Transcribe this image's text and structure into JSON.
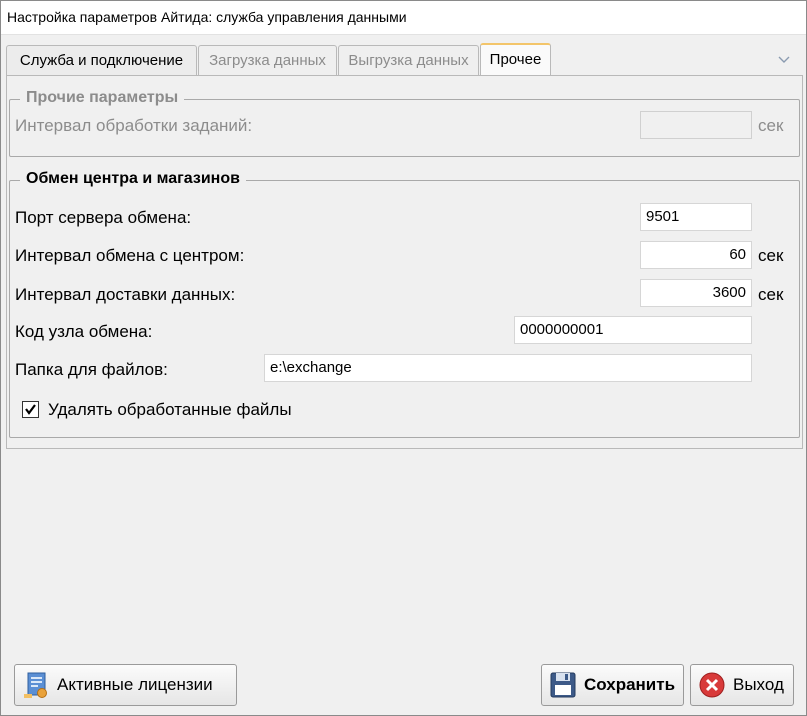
{
  "window": {
    "title": "Настройка параметров Айтида: служба управления данными"
  },
  "tabs": [
    {
      "label": "Служба и подключение"
    },
    {
      "label": "Загрузка данных"
    },
    {
      "label": "Выгрузка данных"
    },
    {
      "label": "Прочее"
    }
  ],
  "other_params": {
    "title": "Прочие параметры",
    "task_interval_label": "Интервал обработки заданий:",
    "task_interval_value": "",
    "task_interval_unit": "сек"
  },
  "exchange": {
    "title": "Обмен центра и магазинов",
    "port_label": "Порт сервера обмена:",
    "port_value": "9501",
    "center_interval_label": "Интервал обмена с центром:",
    "center_interval_value": "60",
    "center_interval_unit": "сек",
    "delivery_interval_label": "Интервал доставки данных:",
    "delivery_interval_value": "3600",
    "delivery_interval_unit": "сек",
    "node_code_label": "Код узла обмена:",
    "node_code_value": "0000000001",
    "folder_label": "Папка для файлов:",
    "folder_value": "e:\\exchange",
    "delete_processed_label": "Удалять обработанные файлы",
    "delete_processed_checked": true
  },
  "buttons": {
    "licenses": "Активные лицензии",
    "save": "Сохранить",
    "exit": "Выход"
  },
  "icons": {
    "tab_overflow": "chevron-down-icon",
    "licenses": "license-document-icon",
    "save": "floppy-disk-icon",
    "exit": "close-circle-icon"
  }
}
